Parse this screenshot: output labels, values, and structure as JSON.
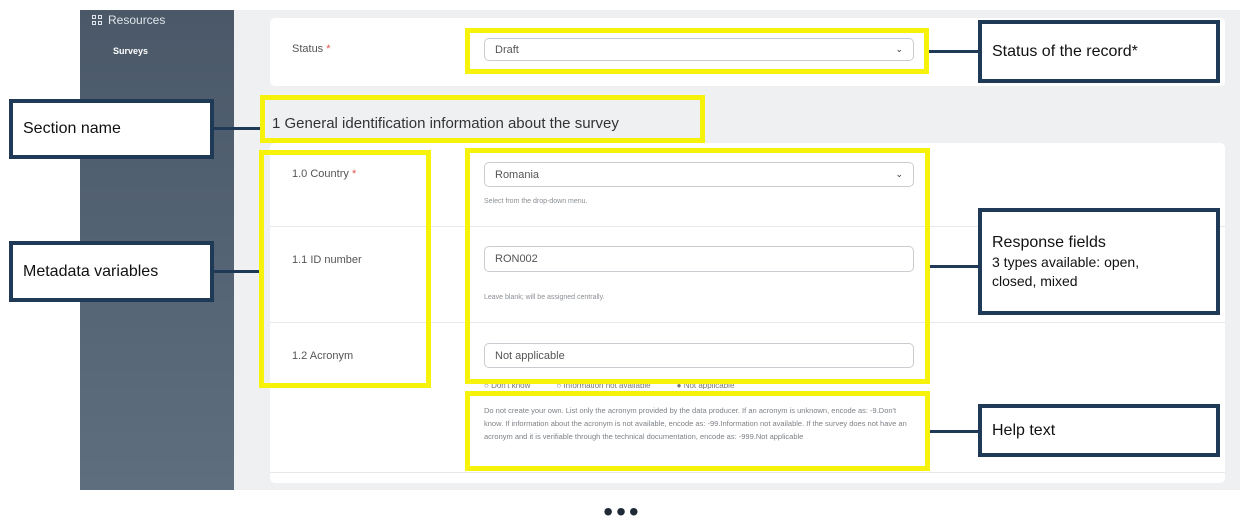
{
  "sidebar": {
    "resources_label": "Resources",
    "surveys_label": "Surveys"
  },
  "status_field": {
    "label": "Status",
    "required_mark": "*",
    "value": "Draft"
  },
  "section": {
    "title": "1 General identification information about the survey"
  },
  "fields": {
    "country": {
      "label": "1.0 Country",
      "required_mark": "*",
      "value": "Romania",
      "help": "Select from the drop-down menu."
    },
    "id_number": {
      "label": "1.1 ID number",
      "value": "RON002",
      "help": "Leave blank; will be assigned centrally."
    },
    "acronym": {
      "label": "1.2 Acronym",
      "value": "Not applicable"
    }
  },
  "acronym_options": [
    "Don't know",
    "Information not available",
    "Not applicable"
  ],
  "acronym_help": "Do not create your own. List only the acronym provided by the data producer. If an acronym is unknown, encode as: -9.Don't know. If information about the acronym is not available, encode as: -99.Information not available. If the survey does not have an acronym and it is verifiable through the technical documentation, encode as: -999.Not applicable",
  "annotations": {
    "status": "Status of the record*",
    "section_name": "Section name",
    "metadata_variables": "Metadata variables",
    "response_fields_title": "Response fields",
    "response_fields_desc_1": "3 types available: open,",
    "response_fields_desc_2": "closed, mixed",
    "help_text": "Help text"
  },
  "footer": {
    "ellipsis": "•••"
  },
  "colors": {
    "highlight": "#f7f20a",
    "callout_border": "#1f3a56",
    "sidebar": "#4e5d6c",
    "required": "#d9534f"
  }
}
